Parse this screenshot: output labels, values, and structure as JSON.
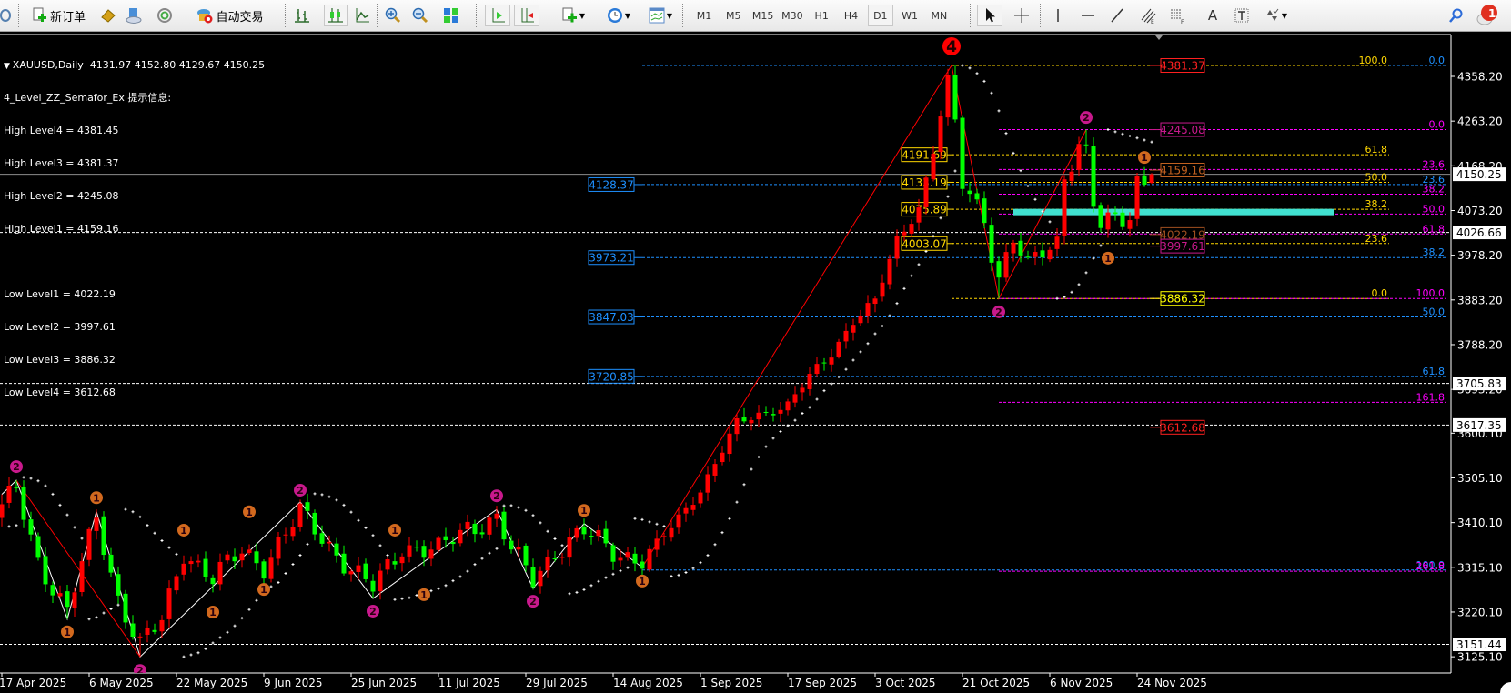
{
  "toolbar": {
    "new_order_label": "新订单",
    "autotrade_label": "自动交易",
    "timeframes": [
      "M1",
      "M5",
      "M15",
      "M30",
      "H1",
      "H4",
      "D1",
      "W1",
      "MN"
    ],
    "active_timeframe": "D1",
    "notification_count": "1"
  },
  "legend": {
    "header": "XAUUSD,Daily  4131.97 4152.80 4129.67 4150.25",
    "indicator_title": "4_Level_ZZ_Semafor_Ex 提示信息:",
    "high_levels": [
      "High Level4 = 4381.45",
      "High Level3 = 4381.37",
      "High Level2 = 4245.08",
      "High Level1 = 4159.16"
    ],
    "low_levels": [
      "Low Level1 = 4022.19",
      "Low Level2 = 3997.61",
      "Low Level3 = 3886.32",
      "Low Level4 = 3612.68"
    ]
  },
  "colors": {
    "up_candle": "#ff0000",
    "down_candle": "#00ff00",
    "fib_blue": "#1e90ff",
    "fib_yellow": "#ffd700",
    "fib_magenta": "#ff00ff",
    "semafor_1": "#d2691e",
    "semafor_2": "#c8198c",
    "semafor_4": "#ff0000",
    "zone": "#40e0d0"
  },
  "chart_data": {
    "type": "candlestick",
    "symbol": "XAUUSD",
    "timeframe": "Daily",
    "last_bar": {
      "open": 4131.97,
      "high": 4152.8,
      "low": 4129.67,
      "close": 4150.25
    },
    "bar_count": 159,
    "close_path": [
      [
        0,
        3440
      ],
      [
        2,
        3480
      ],
      [
        5,
        3330
      ],
      [
        9,
        3220
      ],
      [
        13,
        3420
      ],
      [
        16,
        3250
      ],
      [
        19,
        3150
      ],
      [
        22,
        3200
      ],
      [
        25,
        3350
      ],
      [
        29,
        3290
      ],
      [
        33,
        3350
      ],
      [
        36,
        3320
      ],
      [
        41,
        3430
      ],
      [
        44,
        3380
      ],
      [
        48,
        3310
      ],
      [
        51,
        3270
      ],
      [
        55,
        3360
      ],
      [
        60,
        3350
      ],
      [
        64,
        3400
      ],
      [
        68,
        3420
      ],
      [
        70,
        3350
      ],
      [
        73,
        3290
      ],
      [
        76,
        3350
      ],
      [
        80,
        3390
      ],
      [
        84,
        3350
      ],
      [
        88,
        3330
      ],
      [
        92,
        3400
      ],
      [
        96,
        3480
      ],
      [
        101,
        3620
      ],
      [
        104,
        3640
      ],
      [
        108,
        3660
      ],
      [
        111,
        3720
      ],
      [
        114,
        3770
      ],
      [
        117,
        3840
      ],
      [
        120,
        3880
      ],
      [
        123,
        4010
      ],
      [
        126,
        4080
      ],
      [
        128,
        4200
      ],
      [
        130,
        4350
      ],
      [
        131,
        4250
      ],
      [
        132,
        4130
      ],
      [
        133,
        4110
      ],
      [
        135,
        4060
      ],
      [
        136,
        3990
      ],
      [
        137,
        3930
      ],
      [
        139,
        4010
      ],
      [
        141,
        3950
      ],
      [
        143,
        3990
      ],
      [
        145,
        4010
      ],
      [
        146,
        4150
      ],
      [
        148,
        4210
      ],
      [
        149,
        4190
      ],
      [
        150,
        4080
      ],
      [
        151,
        4040
      ],
      [
        152,
        4050
      ],
      [
        154,
        4060
      ],
      [
        155,
        4070
      ],
      [
        156,
        4140
      ],
      [
        157,
        4132
      ]
    ],
    "zigzag_white": [
      [
        0,
        3470
      ],
      [
        2,
        3500
      ],
      [
        9,
        3205
      ],
      [
        13,
        3434
      ],
      [
        19,
        3125
      ],
      [
        41,
        3454
      ],
      [
        51,
        3249
      ],
      [
        68,
        3438
      ],
      [
        73,
        3270
      ],
      [
        80,
        3408
      ],
      [
        88,
        3315
      ]
    ],
    "zigzag_red": [
      [
        [
          2,
          3500
        ],
        [
          19,
          3125
        ]
      ],
      [
        [
          88,
          3315
        ],
        [
          130.5,
          4381.45
        ],
        [
          137,
          3886.32
        ],
        [
          149,
          4245.08
        ]
      ]
    ],
    "semafor_markers": [
      {
        "n": "2",
        "i": 2,
        "p": 3529,
        "level": 2
      },
      {
        "n": "1",
        "i": 9,
        "p": 3178,
        "level": 1
      },
      {
        "n": "1",
        "i": 13,
        "p": 3463,
        "level": 1
      },
      {
        "n": "2",
        "i": 19,
        "p": 3096,
        "level": 2
      },
      {
        "n": "1",
        "i": 25,
        "p": 3394,
        "level": 1
      },
      {
        "n": "1",
        "i": 29,
        "p": 3220,
        "level": 1
      },
      {
        "n": "1",
        "i": 34,
        "p": 3433,
        "level": 1
      },
      {
        "n": "1",
        "i": 36,
        "p": 3268,
        "level": 1
      },
      {
        "n": "2",
        "i": 41,
        "p": 3479,
        "level": 2
      },
      {
        "n": "2",
        "i": 51,
        "p": 3222,
        "level": 2
      },
      {
        "n": "1",
        "i": 54,
        "p": 3394,
        "level": 1
      },
      {
        "n": "1",
        "i": 58,
        "p": 3257,
        "level": 1
      },
      {
        "n": "2",
        "i": 68,
        "p": 3467,
        "level": 2
      },
      {
        "n": "2",
        "i": 73,
        "p": 3243,
        "level": 2
      },
      {
        "n": "1",
        "i": 80,
        "p": 3436,
        "level": 1
      },
      {
        "n": "1",
        "i": 88,
        "p": 3286,
        "level": 1
      },
      {
        "n": "4",
        "i": 130.5,
        "p": 4422,
        "level": 4
      },
      {
        "n": "2",
        "i": 137,
        "p": 3858,
        "level": 2
      },
      {
        "n": "2",
        "i": 149,
        "p": 4271,
        "level": 2
      },
      {
        "n": "1",
        "i": 152,
        "p": 3972,
        "level": 1
      },
      {
        "n": "1",
        "i": 157,
        "p": 4186,
        "level": 1
      }
    ],
    "fib_blue": {
      "from_bar": 88,
      "levels": [
        [
          "0.0",
          4381.37
        ],
        [
          "23.6",
          4128.37
        ],
        [
          "38.2",
          3973.21
        ],
        [
          "50.0",
          3847.03
        ],
        [
          "61.8",
          3720.85
        ],
        [
          "100.0",
          3309.3
        ]
      ],
      "boxed": [
        "4128.37",
        "3973.21",
        "3847.03",
        "3720.85"
      ]
    },
    "fib_yellow": {
      "from_bar": 130.5,
      "levels": [
        [
          "100.0",
          4381.37
        ],
        [
          "61.8",
          4191.69
        ],
        [
          "50.0",
          4133.19
        ],
        [
          "38.2",
          4075.89
        ],
        [
          "23.6",
          4003.07
        ],
        [
          "0.0",
          3886.32
        ]
      ],
      "boxed": [
        "4191.69",
        "4133.19",
        "4075.89",
        "4003.07"
      ]
    },
    "fib_magenta": {
      "from_bar": 137,
      "levels": [
        [
          "0.0",
          4245.08
        ],
        [
          "23.6",
          4160.4
        ],
        [
          "38.2",
          4108.0
        ],
        [
          "50.0",
          4065.7
        ],
        [
          "61.8",
          4023.4
        ],
        [
          "100.0",
          3886.32
        ],
        [
          "161.8",
          3665.6
        ],
        [
          "261.8",
          3306.8
        ]
      ]
    },
    "level_boxes": [
      {
        "text": "4381.37",
        "p": 4381.37,
        "color": "#ff2020"
      },
      {
        "text": "4245.08",
        "p": 4245.08,
        "color": "#c8198c"
      },
      {
        "text": "4159.16",
        "p": 4159.16,
        "color": "#c06020"
      },
      {
        "text": "4022.19",
        "p": 4022.19,
        "color": "#a05020"
      },
      {
        "text": "3997.61",
        "p": 3997.61,
        "color": "#c8198c"
      },
      {
        "text": "3886.32",
        "p": 3886.32,
        "color": "#ffff00"
      },
      {
        "text": "3612.68",
        "p": 3612.68,
        "color": "#ff2020"
      }
    ],
    "support_zone": {
      "price": 4070,
      "from_bar": 139,
      "to_bar": 183
    },
    "white_lines": [
      "4026.66",
      "3705.83",
      "3617.35",
      "3151.44"
    ],
    "current_price": "4150.25",
    "price_axis": [
      "4358.20",
      "4263.20",
      "4168.20",
      "4073.20",
      "3978.20",
      "3883.20",
      "3788.20",
      "3693.20",
      "3600.10",
      "3505.10",
      "3410.10",
      "3315.10",
      "3220.10",
      "3125.10"
    ],
    "date_axis": [
      "17 Apr 2025",
      "6 May 2025",
      "22 May 2025",
      "9 Jun 2025",
      "25 Jun 2025",
      "11 Jul 2025",
      "29 Jul 2025",
      "14 Aug 2025",
      "1 Sep 2025",
      "17 Sep 2025",
      "3 Oct 2025",
      "21 Oct 2025",
      "6 Nov 2025",
      "24 Nov 2025"
    ]
  }
}
